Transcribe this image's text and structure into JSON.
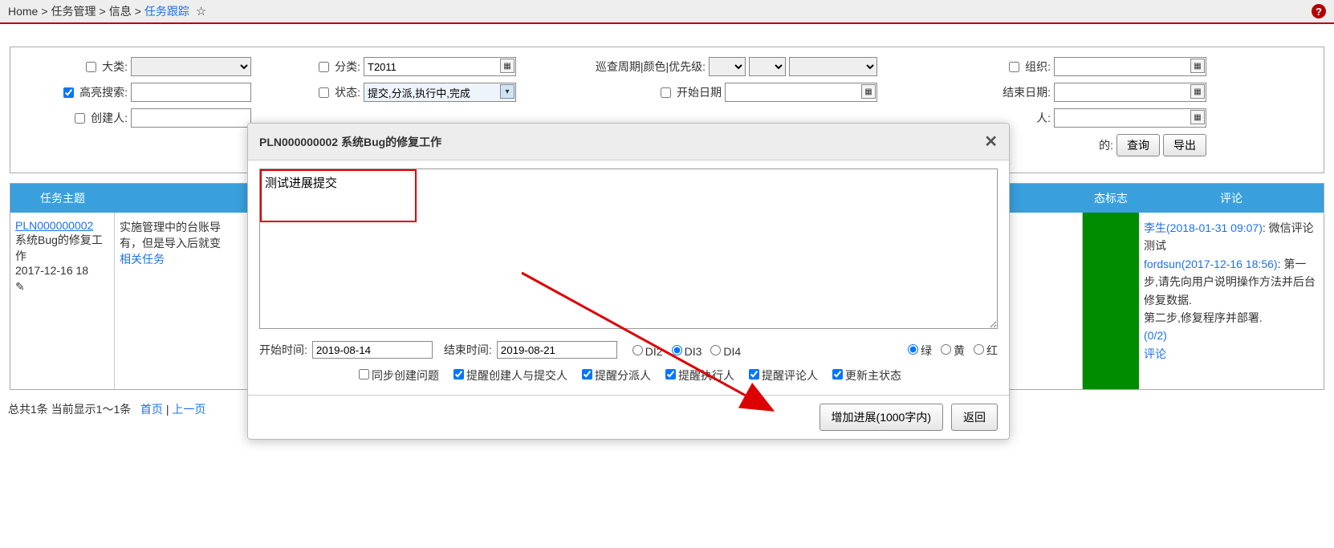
{
  "breadcrumb": {
    "home": "Home",
    "sep": ">",
    "l1": "任务管理",
    "l2": "信息",
    "l3": "任务跟踪"
  },
  "filter": {
    "big_category_label": "大类:",
    "category_label": "分类:",
    "category_value": "T2011",
    "cycle_label": "巡查周期|颜色|优先级:",
    "org_label": "组织:",
    "highlight_label": "高亮搜索:",
    "status_label": "状态:",
    "status_value": "提交,分派,执行中,完成",
    "start_date_label": "开始日期",
    "end_date_label": "结束日期:",
    "creator_label": "创建人:",
    "person_label": "人:",
    "my_label": "的:",
    "query_btn": "查询",
    "export_btn": "导出"
  },
  "table": {
    "th_subject": "任务主题",
    "th_status_flag": "态标志",
    "th_comment": "评论",
    "row": {
      "task_no": "PLN000000002",
      "task_title1": "系统Bug的修复工作",
      "task_title2": "2017-12-16 18",
      "mid_text1": "实施管理中的台账导",
      "mid_text2": "有，但是导入后就变",
      "mid_link": "相关任务",
      "c1_author": "李生(2018-01-31 09:07)",
      "c1_text": ": 微信评论测试",
      "c2_author": "fordsun(2017-12-16 18:56)",
      "c2_text": ": 第一步,请先向用户说明操作方法并后台修复数据.",
      "c3_text": "第二步,修复程序并部署.",
      "progress": "(0/2)",
      "comment_link": "评论"
    }
  },
  "pager": {
    "summary": "总共1条 当前显示1～1条",
    "first": "首页",
    "sep": "|",
    "prev": "上一页"
  },
  "dialog": {
    "title": "PLN000000002 系统Bug的修复工作",
    "textarea_value": "测试进展提交",
    "start_label": "开始时间:",
    "start_value": "2019-08-14",
    "end_label": "结束时间:",
    "end_value": "2019-08-21",
    "di2": "DI2",
    "di3": "DI3",
    "di4": "DI4",
    "green": "绿",
    "yellow": "黄",
    "red": "红",
    "cb_sync": "同步创建问题",
    "cb_notify1": "提醒创建人与提交人",
    "cb_notify2": "提醒分派人",
    "cb_notify3": "提醒执行人",
    "cb_notify4": "提醒评论人",
    "cb_update": "更新主状态",
    "btn_add": "增加进展(1000字内)",
    "btn_back": "返回"
  }
}
